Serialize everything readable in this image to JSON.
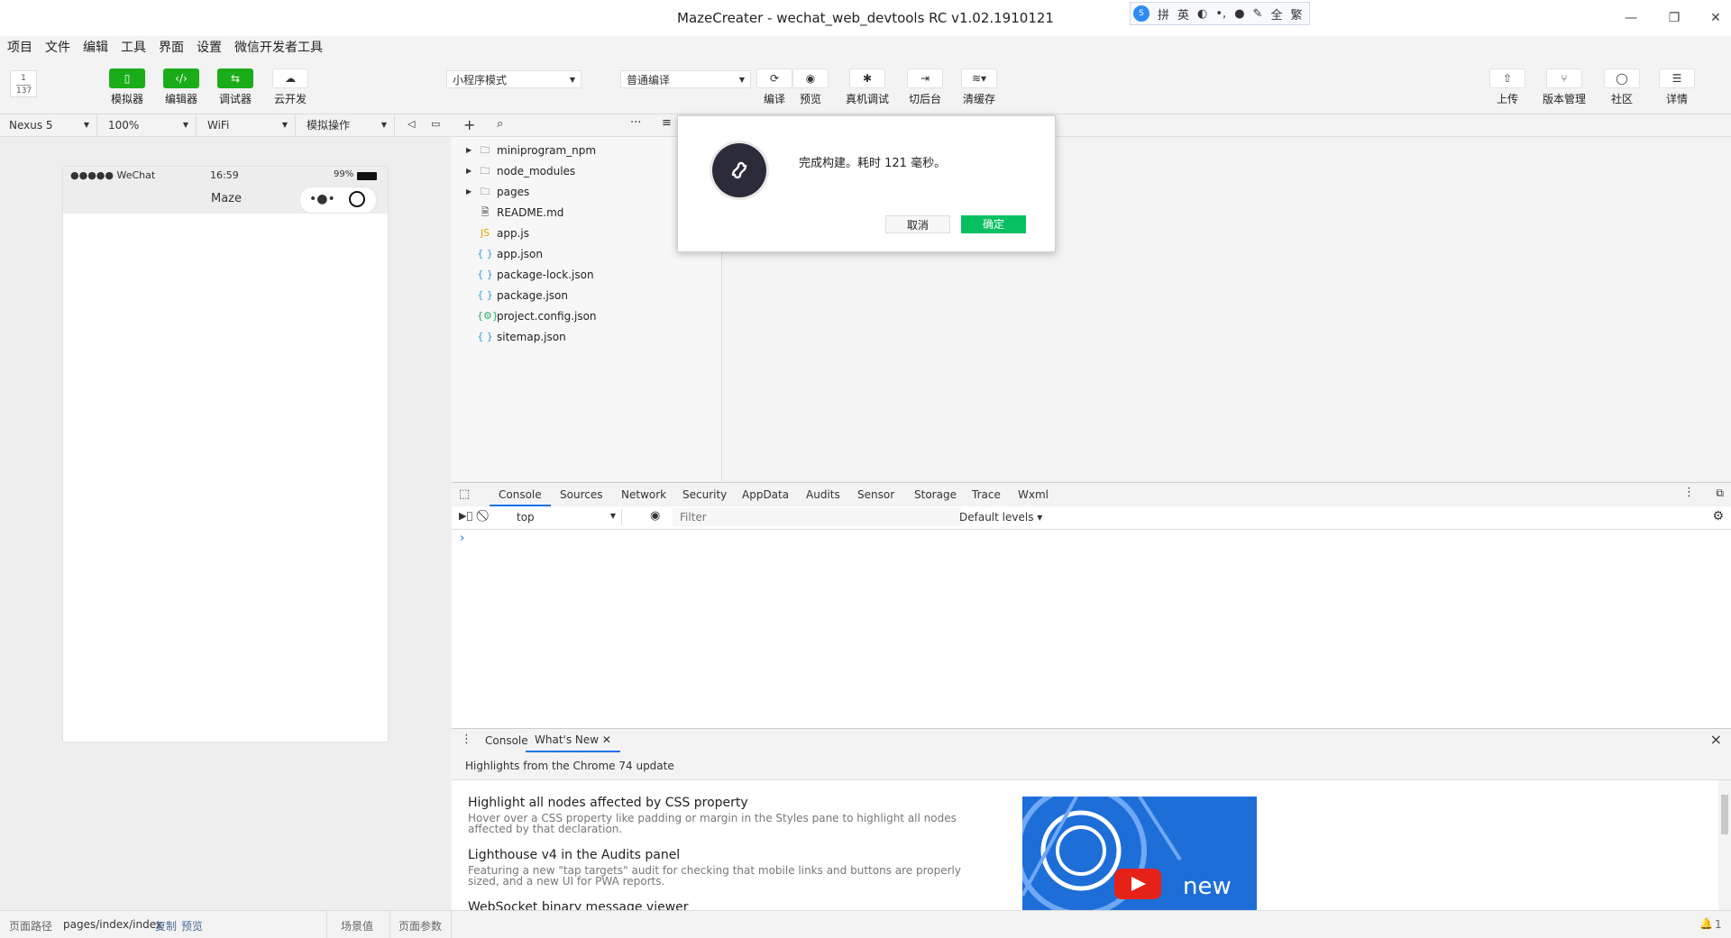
{
  "window": {
    "title": "MazeCreater - wechat_web_devtools RC v1.02.1910121",
    "minimize": "—",
    "restore": "❐",
    "close": "✕"
  },
  "ime": {
    "logo": "sogou",
    "items": [
      "拼",
      "英",
      "◐",
      "•,",
      "🎤",
      "✎",
      "全",
      "繁"
    ]
  },
  "menu": [
    "项目",
    "文件",
    "编辑",
    "工具",
    "界面",
    "设置",
    "微信开发者工具"
  ],
  "toolbar": {
    "avatar_top": "1",
    "avatar_bottom": "137",
    "simulator": "模拟器",
    "editor": "编辑器",
    "debugger": "调试器",
    "cloud": "云开发",
    "mode_select": "小程序模式",
    "compile_select": "普通编译",
    "compile": "编译",
    "preview": "预览",
    "remote_debug": "真机调试",
    "background": "切后台",
    "clear_cache": "清缓存",
    "upload": "上传",
    "version": "版本管理",
    "community": "社区",
    "details": "详情"
  },
  "device_bar": {
    "device": "Nexus 5",
    "zoom": "100%",
    "network": "WiFi",
    "operation": "模拟操作"
  },
  "phone": {
    "carrier": "●●●●● WeChat",
    "time": "16:59",
    "battery": "99%",
    "title": "Maze"
  },
  "filetree": {
    "items": [
      {
        "name": "miniprogram_npm",
        "type": "folder"
      },
      {
        "name": "node_modules",
        "type": "folder"
      },
      {
        "name": "pages",
        "type": "folder"
      },
      {
        "name": "README.md",
        "type": "file"
      },
      {
        "name": "app.js",
        "type": "js"
      },
      {
        "name": "app.json",
        "type": "json"
      },
      {
        "name": "package-lock.json",
        "type": "json"
      },
      {
        "name": "package.json",
        "type": "json"
      },
      {
        "name": "project.config.json",
        "type": "config"
      },
      {
        "name": "sitemap.json",
        "type": "json"
      }
    ]
  },
  "devtools": {
    "tabs": [
      "Console",
      "Sources",
      "Network",
      "Security",
      "AppData",
      "Audits",
      "Sensor",
      "Storage",
      "Trace",
      "Wxml"
    ],
    "context": "top",
    "filter_placeholder": "Filter",
    "levels": "Default levels ▾",
    "prompt": "›"
  },
  "drawer": {
    "tabs": [
      "Console",
      "What's New"
    ],
    "close": "×",
    "headline": "Highlights from the Chrome 74 update",
    "items": [
      {
        "title": "Highlight all nodes affected by CSS property",
        "desc": "Hover over a CSS property like padding or margin in the Styles pane to highlight all nodes affected by that declaration."
      },
      {
        "title": "Lighthouse v4 in the Audits panel",
        "desc": "Featuring a new \"tap targets\" audit for checking that mobile links and buttons are properly sized, and a new UI for PWA reports."
      },
      {
        "title": "WebSocket binary message viewer",
        "desc": ""
      }
    ],
    "video_text": "new"
  },
  "statusbar": {
    "path_label": "页面路径",
    "path": "pages/index/index",
    "copy": "复制",
    "preview": "预览",
    "scene": "场景值",
    "params": "页面参数",
    "notifications": "1"
  },
  "dialog": {
    "message": "完成构建。耗时 121 毫秒。",
    "cancel": "取消",
    "ok": "确定"
  },
  "colors": {
    "accent": "#1aad19",
    "devtools_blue": "#1a73e8",
    "dialog_icon": "#2b2b3a"
  }
}
